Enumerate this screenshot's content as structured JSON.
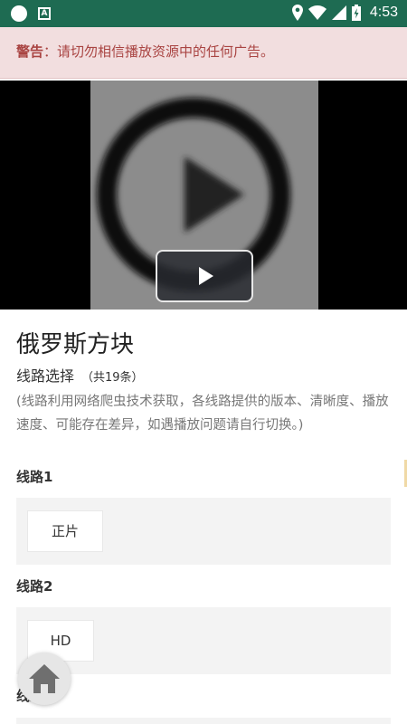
{
  "status_bar": {
    "time": "4:53",
    "icons": [
      "circle-icon",
      "a-box-icon",
      "location-icon",
      "wifi-icon",
      "signal-icon",
      "battery-icon"
    ]
  },
  "warning": {
    "prefix": "警告",
    "text": "：请切勿相信播放资源中的任何广告。"
  },
  "player": {
    "play_icon": "play-icon"
  },
  "page": {
    "title": "俄罗斯方块",
    "line_select_label": "线路选择",
    "line_count_text": "（共19条）",
    "description": "(线路利用网络爬虫技术获取，各线路提供的版本、清晰度、播放速度、可能存在差异，如遇播放问题请自行切换。)"
  },
  "lines": [
    {
      "label": "线路1",
      "episodes": [
        "正片"
      ]
    },
    {
      "label": "线路2",
      "episodes": [
        "HD"
      ]
    },
    {
      "label": "线路3",
      "episodes": []
    }
  ],
  "fab": {
    "icon": "home-icon"
  },
  "colors": {
    "status_bar": "#1e6b52",
    "warning_bg": "#f2dedf",
    "warning_text": "#a94442",
    "line_box_bg": "#f3f3f3"
  }
}
